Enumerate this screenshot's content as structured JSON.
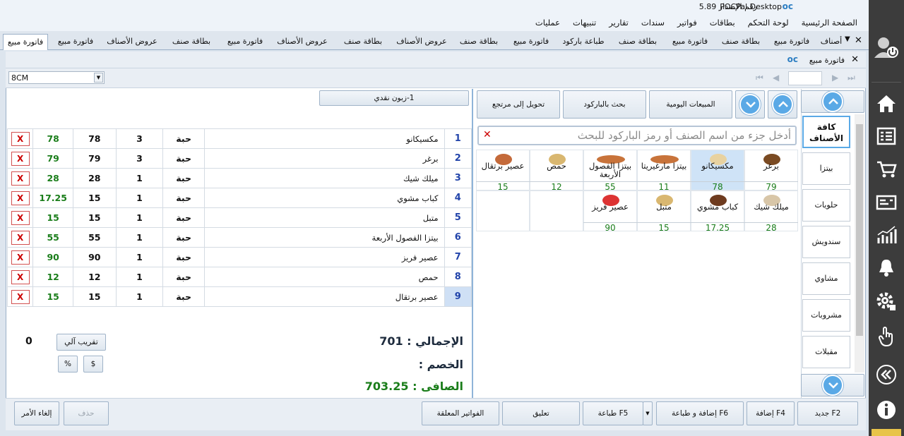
{
  "app": {
    "name": "POCPal Desktop",
    "version_label": "رقم الإصدار 5.89"
  },
  "menu": [
    "الصفحة الرئيسية",
    "لوحة التحكم",
    "بطاقات",
    "فواتير",
    "سندات",
    "تقارير",
    "تنبيهات",
    "عمليات"
  ],
  "tabs": [
    "أصناف",
    "فاتورة مبيع",
    "بطاقة صنف",
    "فاتورة مبيع",
    "بطاقة صنف",
    "طباعة باركود",
    "فاتورة مبيع",
    "بطاقة صنف",
    "عروض الأصناف",
    "بطاقة صنف",
    "عروض الأصناف",
    "فاتورة مبيع",
    "بطاقة صنف",
    "عروض الأصناف",
    "فاتورة مبيع",
    "فاتورة مبيع"
  ],
  "doc_title": "فاتورة مبيع",
  "printer_size": "8CM",
  "customer": "1-زبون نقدي",
  "actions": {
    "return": "تحويل إلى مرتجع",
    "barcode": "بحث بالباركود",
    "daily": "المبيعات اليومية"
  },
  "search": {
    "placeholder": "أدخل جزء من اسم الصنف أو رمز الباركود للبحث"
  },
  "lines": [
    {
      "no": "1",
      "name": "مكسيكانو",
      "unit": "حبة",
      "qty": "3",
      "price": "78",
      "total": "78"
    },
    {
      "no": "2",
      "name": "برغر",
      "unit": "حبة",
      "qty": "3",
      "price": "79",
      "total": "79"
    },
    {
      "no": "3",
      "name": "ميلك شيك",
      "unit": "حبة",
      "qty": "1",
      "price": "28",
      "total": "28"
    },
    {
      "no": "4",
      "name": "كباب مشوي",
      "unit": "حبة",
      "qty": "1",
      "price": "15",
      "total": "17.25"
    },
    {
      "no": "5",
      "name": "متبل",
      "unit": "حبة",
      "qty": "1",
      "price": "15",
      "total": "15"
    },
    {
      "no": "6",
      "name": "بيتزا الفصول الأربعة",
      "unit": "حبة",
      "qty": "1",
      "price": "55",
      "total": "55"
    },
    {
      "no": "7",
      "name": "عصير فريز",
      "unit": "حبة",
      "qty": "1",
      "price": "90",
      "total": "90"
    },
    {
      "no": "8",
      "name": "حمص",
      "unit": "حبة",
      "qty": "1",
      "price": "12",
      "total": "12"
    },
    {
      "no": "9",
      "name": "عصير برتقال",
      "unit": "حبة",
      "qty": "1",
      "price": "15",
      "total": "15"
    }
  ],
  "delete_mark": "X",
  "products_row1": [
    {
      "name": "برغر",
      "price": "79"
    },
    {
      "name": "مكسيكانو",
      "price": "78"
    },
    {
      "name": "بيتزا مارغيريتا",
      "price": "11"
    },
    {
      "name": "بيتزا الفصول الأربعة",
      "price": "55"
    },
    {
      "name": "حمص",
      "price": "12"
    },
    {
      "name": "عصير برتقال",
      "price": "15"
    }
  ],
  "products_row2": [
    {
      "name": "ميلك شيك",
      "price": "28"
    },
    {
      "name": "كباب مشوي",
      "price": "17.25"
    },
    {
      "name": "متبل",
      "price": "15"
    },
    {
      "name": "عصير فريز",
      "price": "90"
    }
  ],
  "categories": [
    "كافة الأصناف",
    "بيتزا",
    "حلويات",
    "سندويش",
    "مشاوي",
    "مشروبات",
    "مقبلات"
  ],
  "totals": {
    "total_label": "الإجمالي : 701",
    "discount_label": "الخصم :",
    "net_label": "الصافى : 703.25",
    "rounding_value": "0"
  },
  "buttons": {
    "auto_round": "تقريب آلي",
    "percent": "%",
    "dollar": "$",
    "cancel": "إلغاء الأمر",
    "delete": "حذف",
    "suspended": "الفواتير المعلقة",
    "hold": "تعليق",
    "print": "طباعة F5",
    "add_print": "إضافة و طباعة F6",
    "add": "إضافة F4",
    "new": "جديد F2"
  },
  "colors": {
    "accent": "#5aa9e6",
    "value_green": "#1a7d1a",
    "delete_red": "#c00000",
    "sidebar": "#3c3c3c"
  }
}
